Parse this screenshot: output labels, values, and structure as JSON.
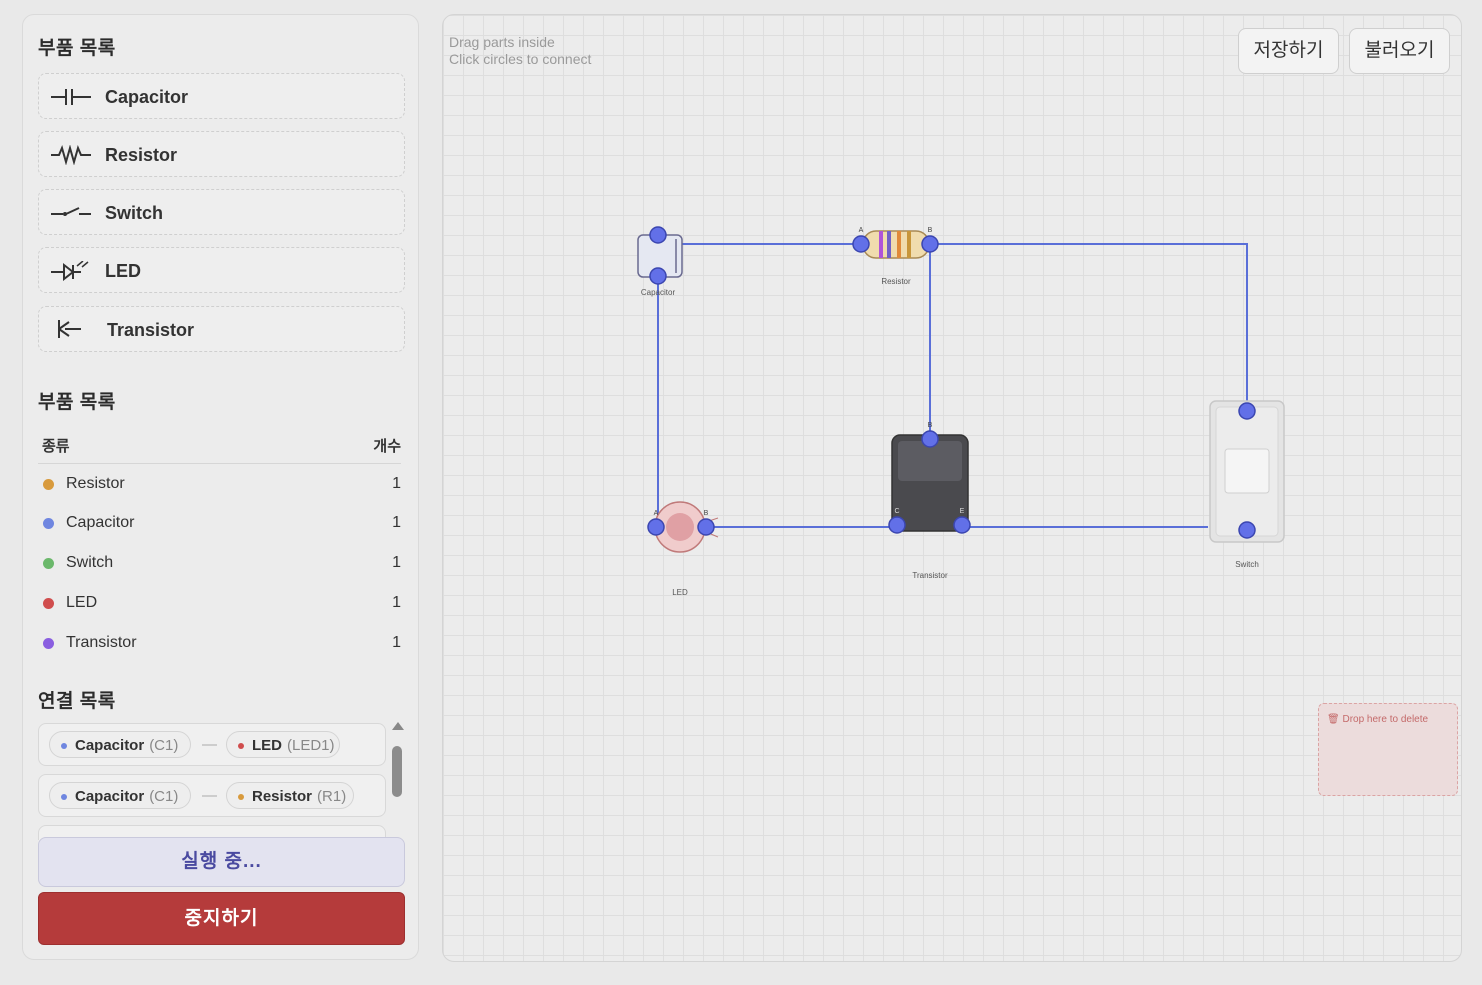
{
  "palette": {
    "title": "부품 목록",
    "items": [
      {
        "label": "Capacitor",
        "icon": "capacitor-symbol-icon"
      },
      {
        "label": "Resistor",
        "icon": "resistor-symbol-icon"
      },
      {
        "label": "Switch",
        "icon": "switch-symbol-icon"
      },
      {
        "label": "LED",
        "icon": "led-symbol-icon"
      },
      {
        "label": "Transistor",
        "icon": "transistor-symbol-icon"
      }
    ]
  },
  "parts_table": {
    "title": "부품 목록",
    "col_type": "종류",
    "col_count": "개수",
    "rows": [
      {
        "name": "Resistor",
        "count": "1",
        "color": "#d89a3c"
      },
      {
        "name": "Capacitor",
        "count": "1",
        "color": "#6f86e0"
      },
      {
        "name": "Switch",
        "count": "1",
        "color": "#6bb86b"
      },
      {
        "name": "LED",
        "count": "1",
        "color": "#d04d4d"
      },
      {
        "name": "Transistor",
        "count": "1",
        "color": "#8a5ee0"
      }
    ]
  },
  "connections": {
    "title": "연결 목록",
    "rows": [
      {
        "a": {
          "name": "Capacitor",
          "id": "(C1)",
          "color": "#6f86e0"
        },
        "sep": "—",
        "b": {
          "name": "LED",
          "id": "(LED1)",
          "color": "#d04d4d"
        }
      },
      {
        "a": {
          "name": "Capacitor",
          "id": "(C1)",
          "color": "#6f86e0"
        },
        "sep": "—",
        "b": {
          "name": "Resistor",
          "id": "(R1)",
          "color": "#d89a3c"
        }
      }
    ]
  },
  "buttons": {
    "running": "실행 중...",
    "stop": "중지하기",
    "save": "저장하기",
    "load": "불러오기"
  },
  "canvas": {
    "hint_line1": "Drag parts inside",
    "hint_line2": "Click circles to connect",
    "trash_label": "🗑 Drop here to delete",
    "wire_color": "#5a6fd8",
    "components": {
      "capacitor": {
        "label": "Capacitor"
      },
      "resistor": {
        "label": "Resistor",
        "pin_a": "A",
        "pin_b": "B"
      },
      "transistor": {
        "label": "Transistor",
        "pin_b": "B",
        "pin_c": "C",
        "pin_e": "E"
      },
      "led": {
        "label": "LED",
        "pin_a": "A",
        "pin_b": "B"
      },
      "switch": {
        "label": "Switch"
      }
    }
  }
}
